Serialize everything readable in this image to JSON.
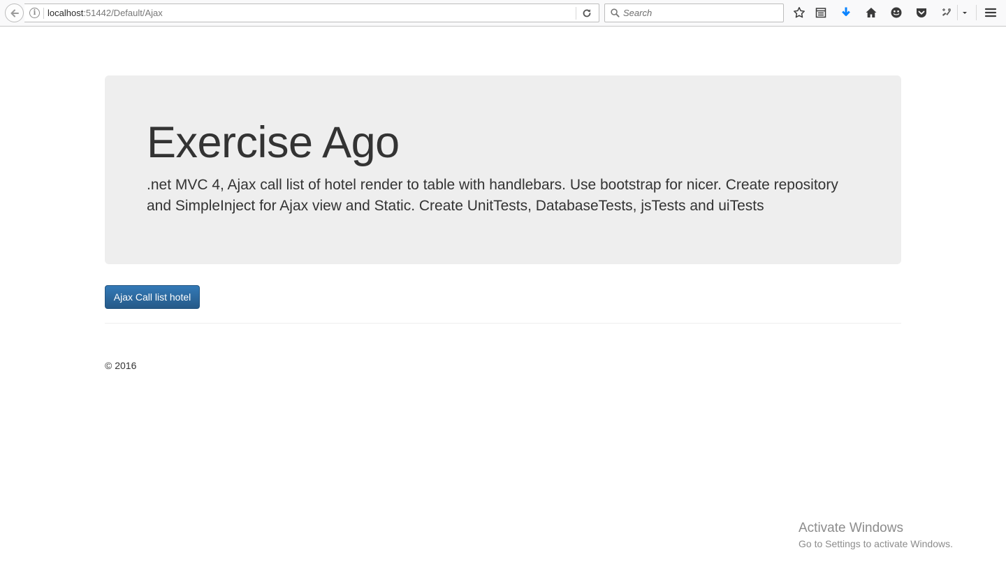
{
  "browser": {
    "address": {
      "host": "localhost",
      "path": ":51442/Default/Ajax"
    },
    "search": {
      "placeholder": "Search",
      "value": ""
    },
    "toolbar_icons": [
      "back-arrow-icon",
      "info-icon",
      "reload-icon",
      "search-icon",
      "bookmark-star-icon",
      "reading-list-icon",
      "download-icon",
      "home-icon",
      "emoji-icon",
      "pocket-icon",
      "extension-icon",
      "dropdown-arrow-icon",
      "hamburger-menu-icon"
    ],
    "colors": {
      "download_accent": "#0a84ff"
    }
  },
  "jumbotron": {
    "title": "Exercise Ago",
    "lead": ".net MVC 4, Ajax call list of hotel render to table with handlebars. Use bootstrap for nicer. Create repository and SimpleInject for Ajax view and Static. Create UnitTests, DatabaseTests, jsTests and uiTests",
    "background": "#eeeeee"
  },
  "actions": {
    "ajax_button_label": "Ajax Call list hotel",
    "button_color": "#337ab7"
  },
  "footer": {
    "copyright": "© 2016"
  },
  "watermark": {
    "title": "Activate Windows",
    "subtitle": "Go to Settings to activate Windows."
  }
}
